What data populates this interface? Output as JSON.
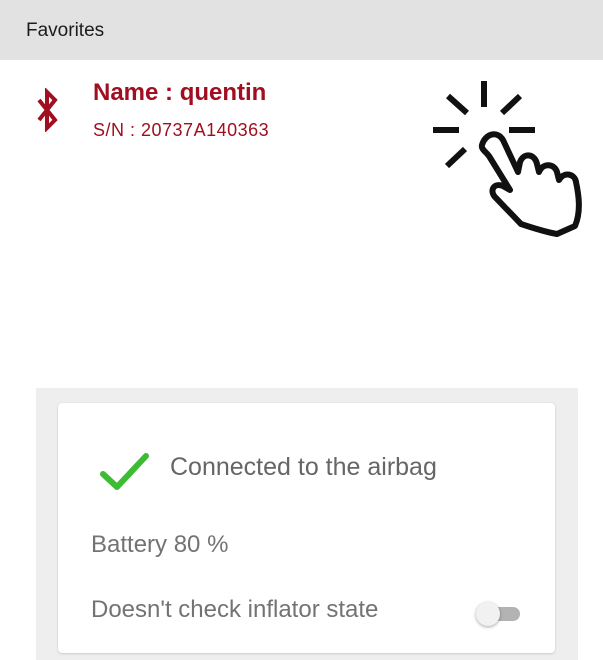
{
  "favorites": {
    "title": "Favorites"
  },
  "device": {
    "icon": "bluetooth-icon",
    "name": "Name : quentin",
    "serial": "S/N : 20737A140363"
  },
  "gesture": {
    "icon": "tap-hand-icon"
  },
  "status": {
    "check_icon": "check-icon",
    "connection_text": "Connected to the airbag",
    "battery_text": "Battery 80 %",
    "inflator_text": "Doesn't check inflator state",
    "inflator_check_enabled": false
  },
  "colors": {
    "accent": "#a00e1f",
    "success": "#3dbb32",
    "header_bg": "#e2e2e2"
  }
}
